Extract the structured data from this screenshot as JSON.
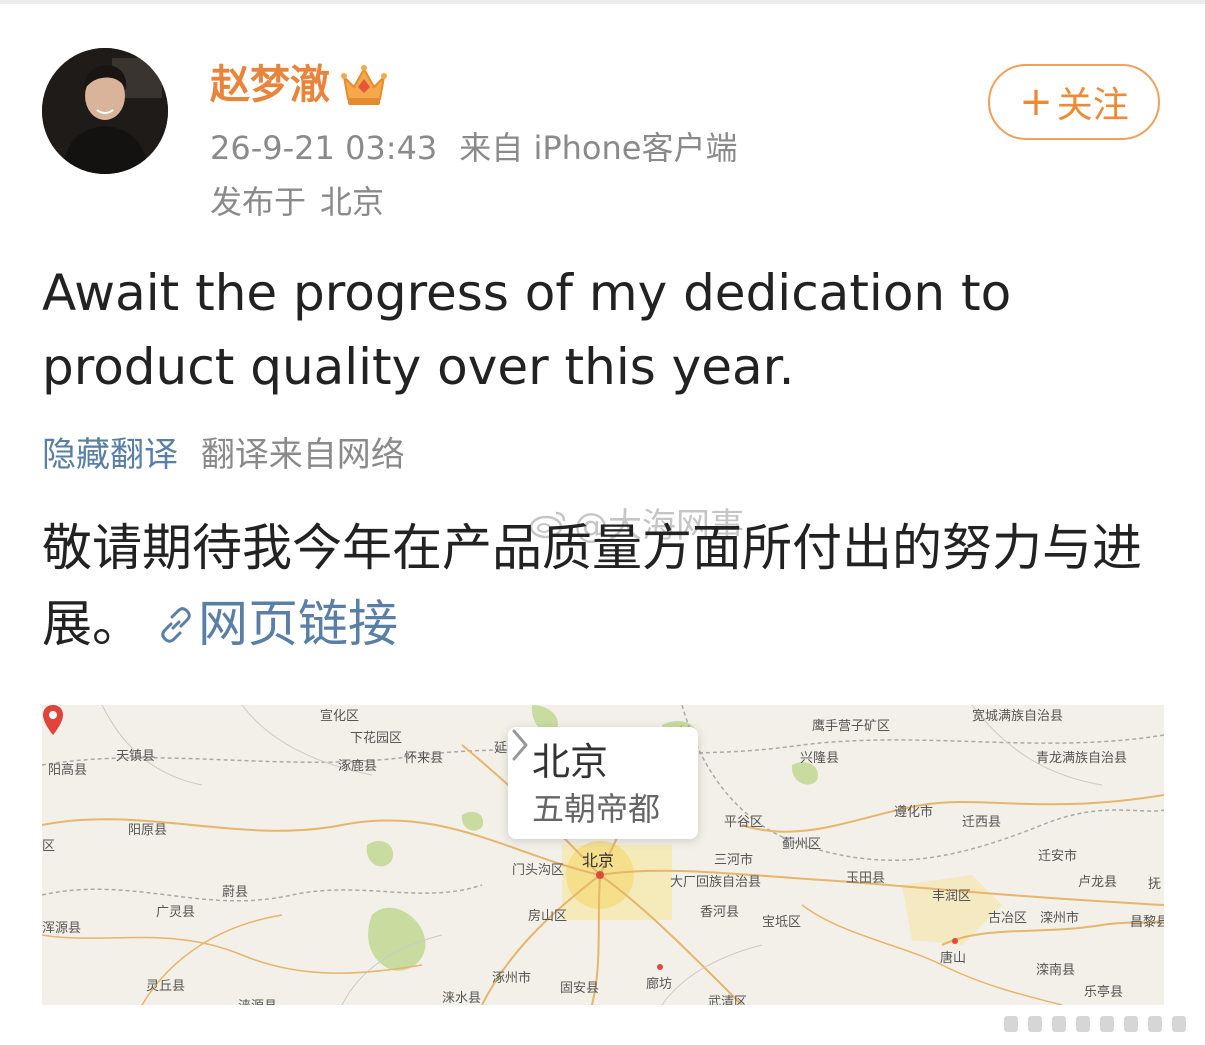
{
  "user": {
    "name": "赵梦澈",
    "time": "26-9-21 03:43",
    "source": "来自 iPhone客户端",
    "location_prefix": "发布于",
    "location": "北京",
    "follow_label": "关注",
    "follow_plus": "+"
  },
  "post": {
    "text_en": "Await the progress of my dedication to product quality over this year.",
    "hide_translation": "隐藏翻译",
    "translation_source": "翻译来自网络",
    "text_cn": "敬请期待我今年在产品质量方面所付出的努力与进展。",
    "link_label": "网页链接"
  },
  "watermark": "@大海网事",
  "map": {
    "popup_title": "北京",
    "popup_subtitle": "五朝帝都",
    "pin_label": "北京",
    "labels": [
      {
        "text": "宣化区"
      },
      {
        "text": "下花园区"
      },
      {
        "text": "天镇县"
      },
      {
        "text": "阳高县"
      },
      {
        "text": "涿鹿县"
      },
      {
        "text": "怀来县"
      },
      {
        "text": "延"
      },
      {
        "text": "鹰手营子矿区"
      },
      {
        "text": "兴隆县"
      },
      {
        "text": "宽城满族自治县"
      },
      {
        "text": "青龙满族自治县"
      },
      {
        "text": "遵化市"
      },
      {
        "text": "迁西县"
      },
      {
        "text": "平谷区"
      },
      {
        "text": "阳原县"
      },
      {
        "text": "区"
      },
      {
        "text": "门头沟区"
      },
      {
        "text": "三河市"
      },
      {
        "text": "蓟州区"
      },
      {
        "text": "迁安市"
      },
      {
        "text": "大厂回族自治县"
      },
      {
        "text": "玉田县"
      },
      {
        "text": "丰润区"
      },
      {
        "text": "卢龙县"
      },
      {
        "text": "抚"
      },
      {
        "text": "蔚县"
      },
      {
        "text": "房山区"
      },
      {
        "text": "香河县"
      },
      {
        "text": "宝坻区"
      },
      {
        "text": "古冶区"
      },
      {
        "text": "滦州市"
      },
      {
        "text": "昌黎县"
      },
      {
        "text": "广灵县"
      },
      {
        "text": "浑源县"
      },
      {
        "text": "唐山"
      },
      {
        "text": "涿州市"
      },
      {
        "text": "廊坊"
      },
      {
        "text": "滦南县"
      },
      {
        "text": "灵丘县"
      },
      {
        "text": "涞水县"
      },
      {
        "text": "固安县"
      },
      {
        "text": "武清区"
      },
      {
        "text": "乐亭县"
      },
      {
        "text": "涞源县"
      }
    ]
  }
}
